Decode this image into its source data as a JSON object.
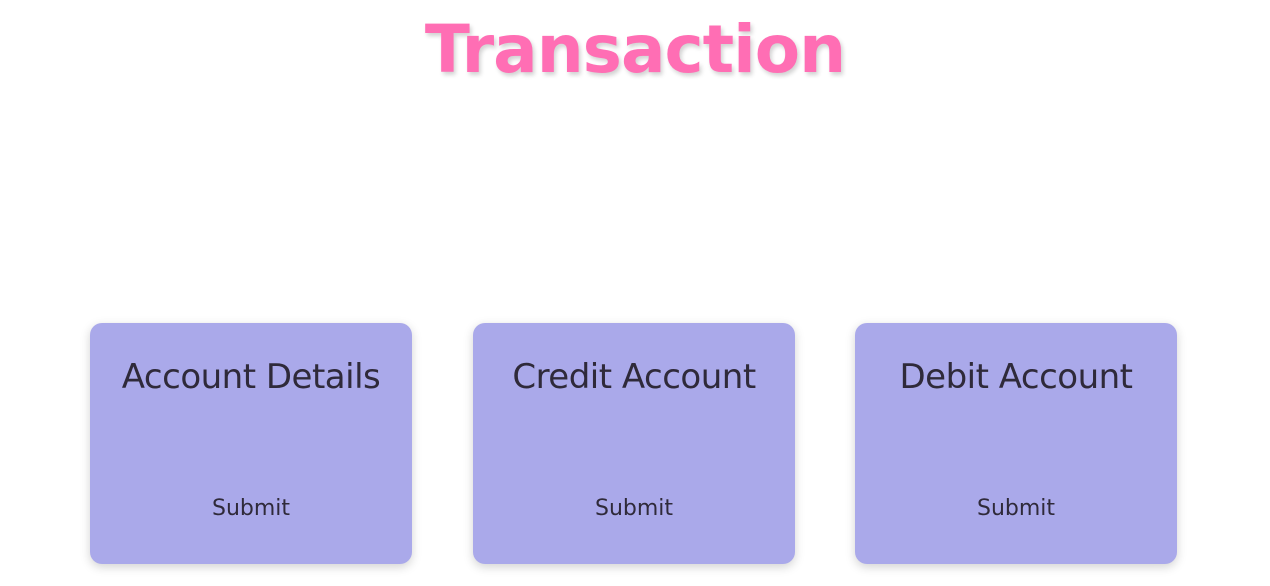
{
  "header": {
    "title": "Transaction"
  },
  "cards": [
    {
      "title": "Account Details",
      "button_label": "Submit"
    },
    {
      "title": "Credit Account",
      "button_label": "Submit"
    },
    {
      "title": "Debit Account",
      "button_label": "Submit"
    }
  ],
  "colors": {
    "title": "#ff6eb4",
    "card_background": "#aaa9ea",
    "card_text": "#2f2a3a",
    "page_background": "#ffffff"
  }
}
